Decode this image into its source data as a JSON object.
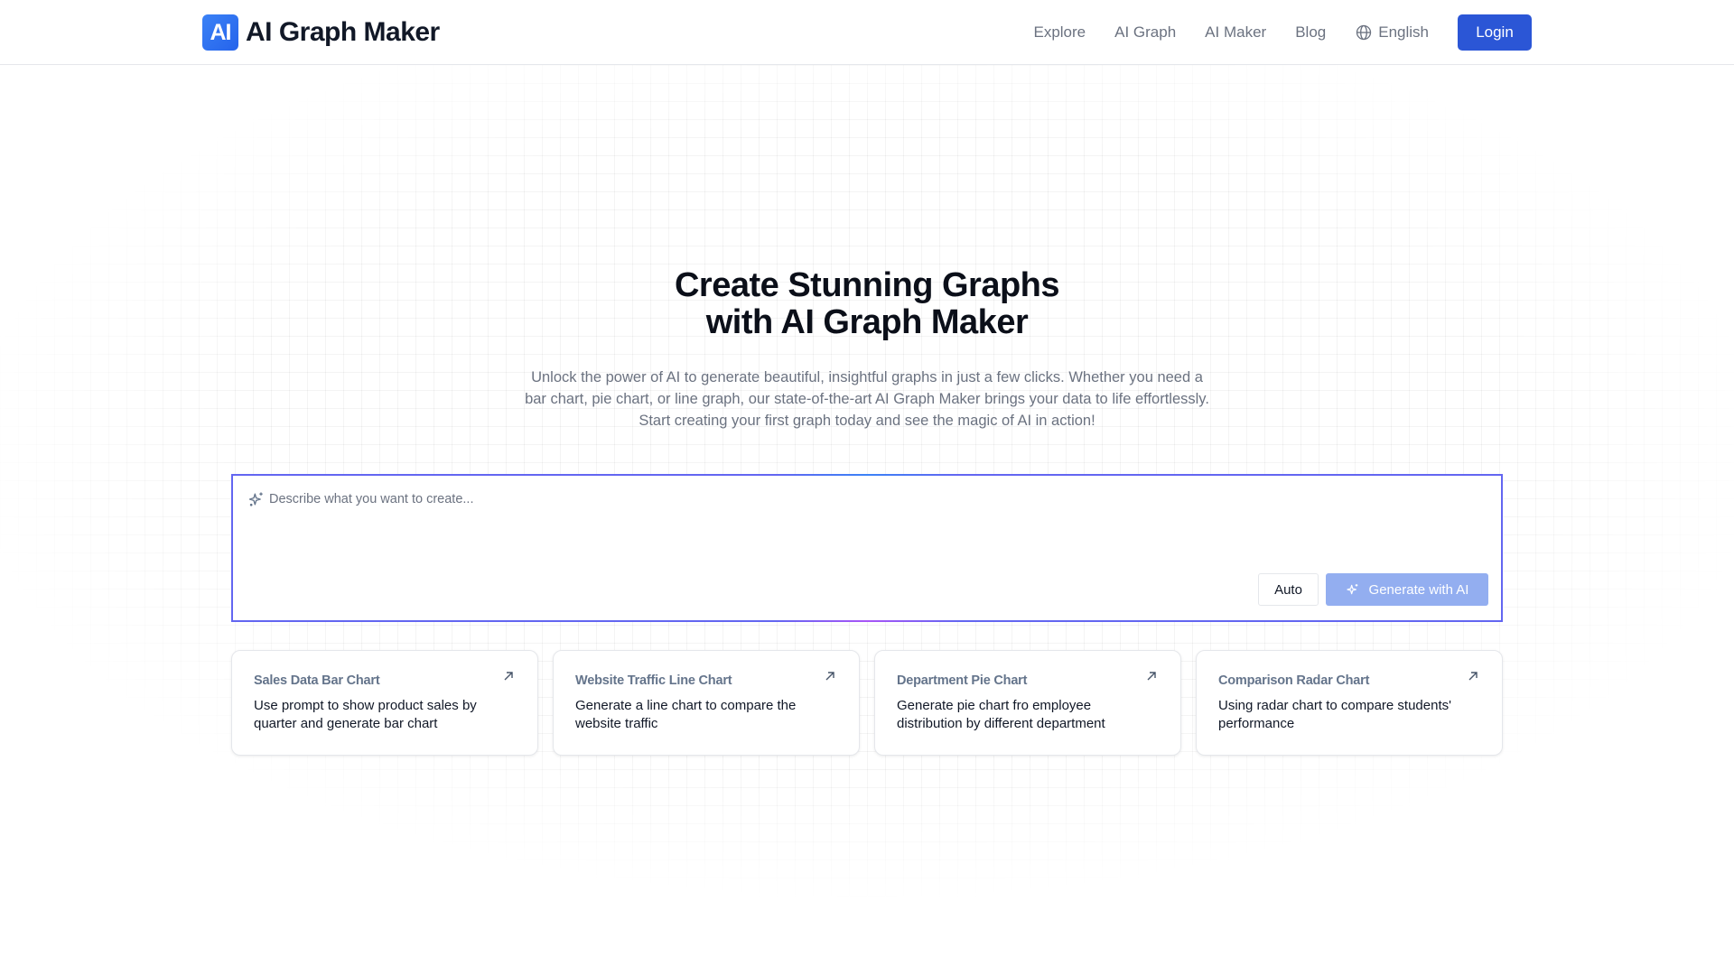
{
  "header": {
    "logo_badge": "AI",
    "logo_text": "AI Graph Maker",
    "nav": [
      "Explore",
      "AI Graph",
      "AI Maker",
      "Blog"
    ],
    "language": "English",
    "language_icon": "globe-icon",
    "login_label": "Login"
  },
  "hero": {
    "title_line1": "Create Stunning Graphs",
    "title_line2": "with AI Graph Maker",
    "subtitle": "Unlock the power of AI to generate beautiful, insightful graphs in just a few clicks. Whether you need a bar chart, pie chart, or line graph, our state-of-the-art AI Graph Maker brings your data to life effortlessly. Start creating your first graph today and see the magic of AI in action!"
  },
  "prompt": {
    "placeholder": "Describe what you want to create...",
    "value": "",
    "icon": "sparkles-icon",
    "mode_label": "Auto",
    "generate_label": "Generate with AI"
  },
  "examples": [
    {
      "title": "Sales Data Bar Chart",
      "description": "Use prompt to show product sales by quarter and generate bar chart"
    },
    {
      "title": "Website Traffic Line Chart",
      "description": "Generate a line chart to compare the website traffic"
    },
    {
      "title": "Department Pie Chart",
      "description": "Generate pie chart fro employee distribution by different department"
    },
    {
      "title": "Comparison Radar Chart",
      "description": "Using radar chart to compare students' performance"
    }
  ],
  "colors": {
    "brand": "#2b56d6",
    "prompt_border": "#6366f1",
    "generate_disabled": "#93aef0"
  }
}
